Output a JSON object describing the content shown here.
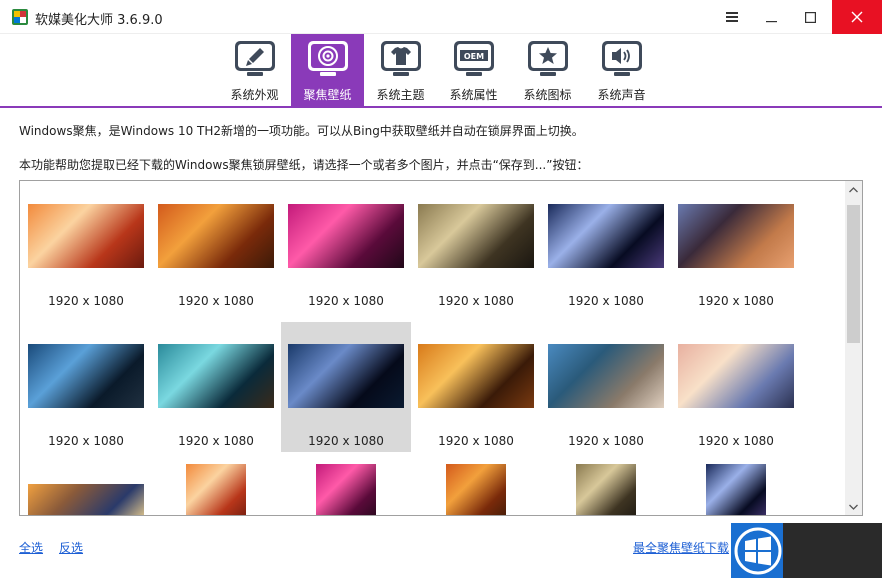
{
  "window": {
    "title": "软媒美化大师 3.6.9.0",
    "menu_icon": "hamburger-icon",
    "min_icon": "minimize-icon",
    "max_icon": "maximize-icon",
    "close_icon": "close-icon",
    "close_color": "#e81123"
  },
  "tabs": [
    {
      "label": "系统外观",
      "icon": "brush-icon",
      "active": false
    },
    {
      "label": "聚焦壁纸",
      "icon": "spotlight-icon",
      "active": true
    },
    {
      "label": "系统主题",
      "icon": "tshirt-icon",
      "active": false
    },
    {
      "label": "系统属性",
      "icon": "oem-icon",
      "active": false
    },
    {
      "label": "系统图标",
      "icon": "star-icon",
      "active": false
    },
    {
      "label": "系统声音",
      "icon": "speaker-icon",
      "active": false
    }
  ],
  "accent_color": "#8a3ab9",
  "description": {
    "line1": "Windows聚焦，是Windows 10 TH2新增的一项功能。可以从Bing中获取壁纸并自动在锁屏界面上切换。",
    "line2": "本功能帮助您提取已经下载的Windows聚焦锁屏壁纸，请选择一个或者多个图片，并点击“保存到...”按钮："
  },
  "gallery": {
    "items": [
      {
        "dim": "1920 x 1080",
        "theme": "canyon"
      },
      {
        "dim": "1920 x 1080",
        "theme": "autumn-tree"
      },
      {
        "dim": "1920 x 1080",
        "theme": "pink-tunnel"
      },
      {
        "dim": "1920 x 1080",
        "theme": "owl"
      },
      {
        "dim": "1920 x 1080",
        "theme": "star-trails"
      },
      {
        "dim": "1920 x 1080",
        "theme": "grand-canyon"
      },
      {
        "dim": "1920 x 1080",
        "theme": "blue-stairs"
      },
      {
        "dim": "1920 x 1080",
        "theme": "ice-cave"
      },
      {
        "dim": "1920 x 1080",
        "theme": "night-sky",
        "selected": true
      },
      {
        "dim": "1920 x 1080",
        "theme": "golden-tunnel"
      },
      {
        "dim": "1920 x 1080",
        "theme": "mountain-lake"
      },
      {
        "dim": "1920 x 1080",
        "theme": "sunset-boat"
      }
    ],
    "portrait_items": [
      {
        "theme": "sunset-ruins"
      },
      {
        "theme": "canyon"
      },
      {
        "theme": "pink-tunnel"
      },
      {
        "theme": "autumn-tree"
      },
      {
        "theme": "owl"
      },
      {
        "theme": "star-trails"
      }
    ]
  },
  "footer": {
    "select_all": "全选",
    "invert": "反选",
    "download": "最全聚焦壁纸下载"
  }
}
